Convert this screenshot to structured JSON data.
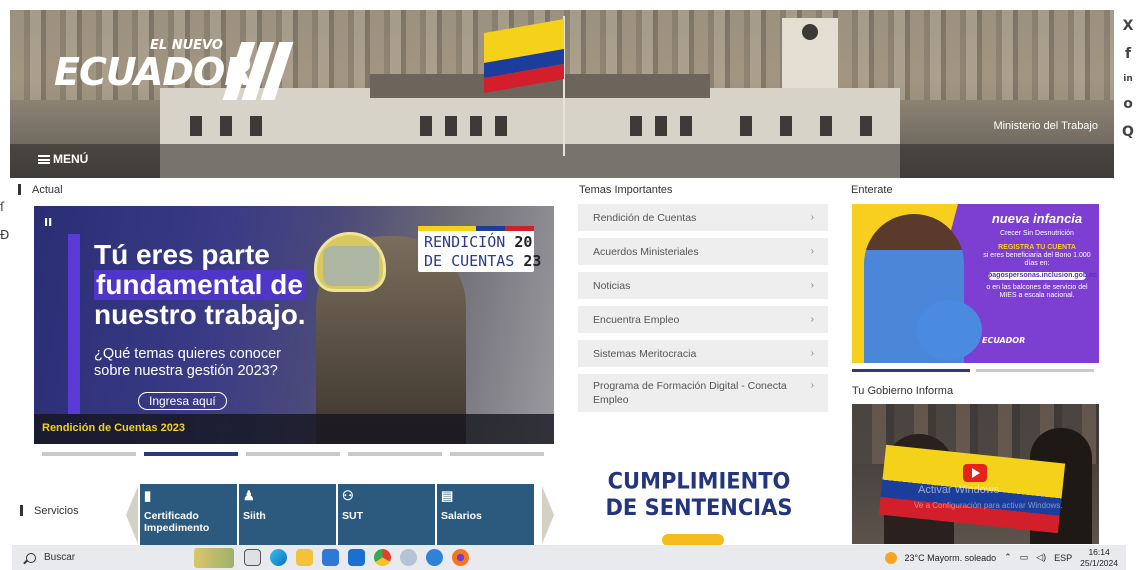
{
  "header": {
    "logo_top": "EL NUEVO",
    "logo_main": "ECUADOR",
    "ministry": "Ministerio del Trabajo",
    "menu_label": "MENÚ",
    "social": [
      "X",
      "f",
      "in",
      "o",
      "Q"
    ]
  },
  "sections": {
    "actual": "Actual",
    "temas": "Temas Importantes",
    "enterate": "Enterate",
    "gobierno": "Tu Gobierno Informa",
    "servicios": "Servicios"
  },
  "banner": {
    "pause": "II",
    "headline_1": "Tú eres parte",
    "headline_2": "fundamental de",
    "headline_3": "nuestro trabajo.",
    "question": "¿Qué temas quieres conocer sobre nuestra gestión 2023?",
    "cta": "Ingresa aquí",
    "badge_line1": "RENDICIÓN",
    "badge_year1": "20",
    "badge_line2": "DE CUENTAS",
    "badge_year2": "23",
    "caption": "Rendición de Cuentas 2023"
  },
  "carousel": {
    "count": 5,
    "active": 1
  },
  "temas": [
    {
      "label": "Rendición de Cuentas"
    },
    {
      "label": "Acuerdos Ministeriales"
    },
    {
      "label": "Noticias"
    },
    {
      "label": "Encuentra Empleo"
    },
    {
      "label": "Sistemas Meritocracia"
    },
    {
      "label": "Programa de Formación Digital - Conecta Empleo"
    }
  ],
  "cumplimiento": {
    "line1": "CUMPLIMIENTO",
    "line2": "DE SENTENCIAS"
  },
  "servicios": [
    {
      "label": "Certificado Impedimento",
      "icon": "document-icon"
    },
    {
      "label": "Siith",
      "icon": "user-icon"
    },
    {
      "label": "SUT",
      "icon": "group-icon"
    },
    {
      "label": "Salarios",
      "icon": "table-icon"
    }
  ],
  "enterate_ad": {
    "brand": "nueva infancia",
    "sub": "Crecer Sin Desnutrición",
    "registra": "REGISTRA TU CUENTA",
    "body": "si eres beneficiaria del Bono 1.000 días en:",
    "pill": "pagospersonas.inclusion.gob.ec",
    "foot": "o en las balcones de servicio del MIES a escala nacional.",
    "logo": "ECUADOR"
  },
  "video": {
    "watermark": "Activar Windows",
    "watermark_sub": "Ve a Configuración para activar Windows."
  },
  "taskbar": {
    "search": "Buscar",
    "weather": "23°C  Mayorm. soleado",
    "lang": "ESP",
    "time": "16:14",
    "date": "25/1/2024"
  }
}
